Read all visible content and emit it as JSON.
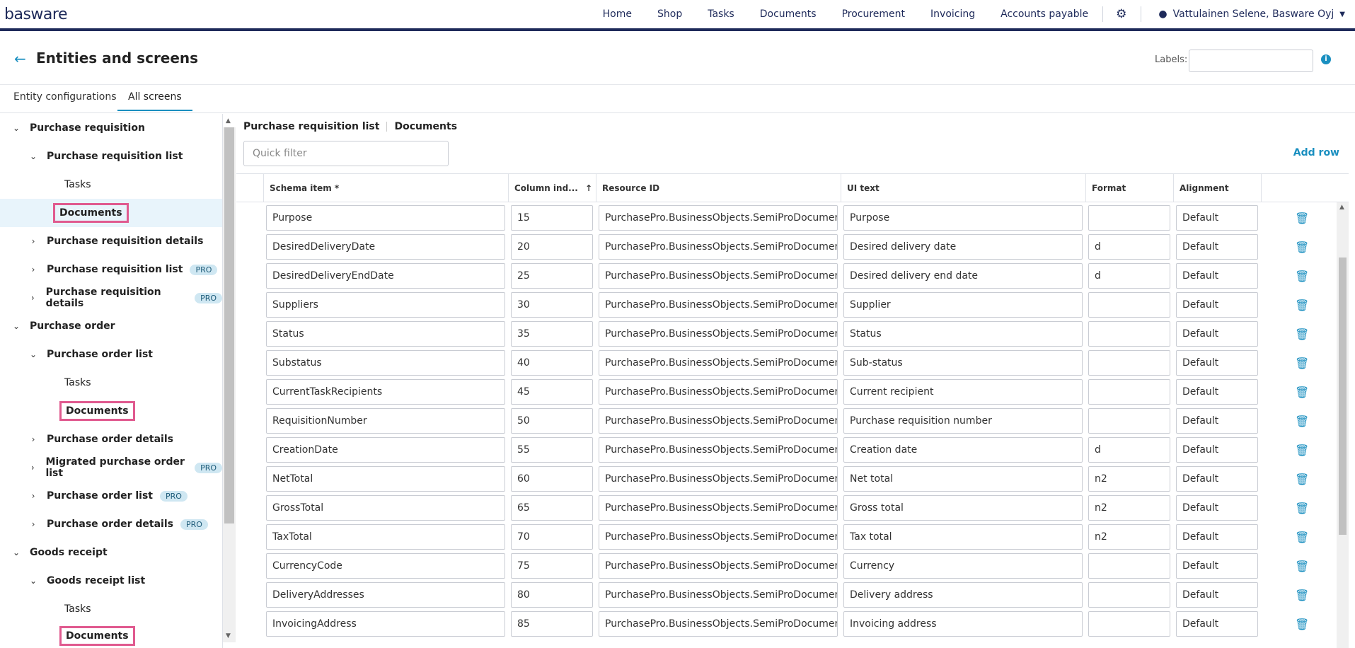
{
  "app": {
    "logo": "basware"
  },
  "topnav": {
    "items": [
      "Home",
      "Shop",
      "Tasks",
      "Documents",
      "Procurement",
      "Invoicing",
      "Accounts payable"
    ],
    "user": "Vattulainen Selene, Basware Oyj"
  },
  "page": {
    "title": "Entities and screens",
    "labels_label": "Labels:",
    "labels_value": ""
  },
  "tabs": [
    "Entity configurations",
    "All screens"
  ],
  "active_tab": "All screens",
  "sidebar": {
    "items": [
      {
        "label": "Purchase requisition",
        "level": 0,
        "expanded": true
      },
      {
        "label": "Purchase requisition list",
        "level": 1,
        "expanded": true
      },
      {
        "label": "Tasks",
        "level": 2
      },
      {
        "label": "Documents",
        "level": 2,
        "selected": true,
        "highlighted": true
      },
      {
        "label": "Purchase requisition details",
        "level": 1,
        "expanded": false
      },
      {
        "label": "Purchase requisition list",
        "level": 1,
        "expanded": false,
        "badge": "PRO"
      },
      {
        "label": "Purchase requisition details",
        "level": 1,
        "expanded": false,
        "badge": "PRO"
      },
      {
        "label": "Purchase order",
        "level": 0,
        "expanded": true
      },
      {
        "label": "Purchase order list",
        "level": 1,
        "expanded": true
      },
      {
        "label": "Tasks",
        "level": 2
      },
      {
        "label": "Documents",
        "level": 2,
        "highlighted": true
      },
      {
        "label": "Purchase order details",
        "level": 1,
        "expanded": false
      },
      {
        "label": "Migrated purchase order list",
        "level": 1,
        "expanded": false,
        "badge": "PRO"
      },
      {
        "label": "Purchase order list",
        "level": 1,
        "expanded": false,
        "badge": "PRO"
      },
      {
        "label": "Purchase order details",
        "level": 1,
        "expanded": false,
        "badge": "PRO"
      },
      {
        "label": "Goods receipt",
        "level": 0,
        "expanded": true
      },
      {
        "label": "Goods receipt list",
        "level": 1,
        "expanded": true
      },
      {
        "label": "Tasks",
        "level": 2
      },
      {
        "label": "Documents",
        "level": 2,
        "highlighted": true
      }
    ]
  },
  "main": {
    "breadcrumb": [
      "Purchase requisition list",
      "Documents"
    ],
    "quick_filter_placeholder": "Quick filter",
    "add_row": "Add row",
    "columns": [
      "Schema item *",
      "Column ind...",
      "Resource ID",
      "UI text",
      "Format",
      "Alignment"
    ],
    "sort_indicator": "↑",
    "rows": [
      {
        "schema": "Purpose",
        "index": "15",
        "resource": "PurchasePro.BusinessObjects.SemiProDocumen...",
        "ui": "Purpose",
        "format": "",
        "align": "Default"
      },
      {
        "schema": "DesiredDeliveryDate",
        "index": "20",
        "resource": "PurchasePro.BusinessObjects.SemiProDocumen...",
        "ui": "Desired delivery date",
        "format": "d",
        "align": "Default"
      },
      {
        "schema": "DesiredDeliveryEndDate",
        "index": "25",
        "resource": "PurchasePro.BusinessObjects.SemiProDocumen...",
        "ui": "Desired delivery end date",
        "format": "d",
        "align": "Default"
      },
      {
        "schema": "Suppliers",
        "index": "30",
        "resource": "PurchasePro.BusinessObjects.SemiProDocumen...",
        "ui": "Supplier",
        "format": "",
        "align": "Default"
      },
      {
        "schema": "Status",
        "index": "35",
        "resource": "PurchasePro.BusinessObjects.SemiProDocumen...",
        "ui": "Status",
        "format": "",
        "align": "Default"
      },
      {
        "schema": "Substatus",
        "index": "40",
        "resource": "PurchasePro.BusinessObjects.SemiProDocumen...",
        "ui": "Sub-status",
        "format": "",
        "align": "Default"
      },
      {
        "schema": "CurrentTaskRecipients",
        "index": "45",
        "resource": "PurchasePro.BusinessObjects.SemiProDocumen...",
        "ui": "Current recipient",
        "format": "",
        "align": "Default"
      },
      {
        "schema": "RequisitionNumber",
        "index": "50",
        "resource": "PurchasePro.BusinessObjects.SemiProDocumen...",
        "ui": "Purchase requisition number",
        "format": "",
        "align": "Default"
      },
      {
        "schema": "CreationDate",
        "index": "55",
        "resource": "PurchasePro.BusinessObjects.SemiProDocumen...",
        "ui": "Creation date",
        "format": "d",
        "align": "Default"
      },
      {
        "schema": "NetTotal",
        "index": "60",
        "resource": "PurchasePro.BusinessObjects.SemiProDocumen...",
        "ui": "Net total",
        "format": "n2",
        "align": "Default"
      },
      {
        "schema": "GrossTotal",
        "index": "65",
        "resource": "PurchasePro.BusinessObjects.SemiProDocumen...",
        "ui": "Gross total",
        "format": "n2",
        "align": "Default"
      },
      {
        "schema": "TaxTotal",
        "index": "70",
        "resource": "PurchasePro.BusinessObjects.SemiProDocumen...",
        "ui": "Tax total",
        "format": "n2",
        "align": "Default"
      },
      {
        "schema": "CurrencyCode",
        "index": "75",
        "resource": "PurchasePro.BusinessObjects.SemiProDocumen...",
        "ui": "Currency",
        "format": "",
        "align": "Default"
      },
      {
        "schema": "DeliveryAddresses",
        "index": "80",
        "resource": "PurchasePro.BusinessObjects.SemiProDocumen...",
        "ui": "Delivery address",
        "format": "",
        "align": "Default"
      },
      {
        "schema": "InvoicingAddress",
        "index": "85",
        "resource": "PurchasePro.BusinessObjects.SemiProDocumen...",
        "ui": "Invoicing address",
        "format": "",
        "align": "Default"
      }
    ]
  },
  "colors": {
    "accent": "#1a8fc0",
    "navy": "#1e2a5a",
    "highlight": "#e05a8f",
    "pro_badge": "#cfe7f2"
  }
}
